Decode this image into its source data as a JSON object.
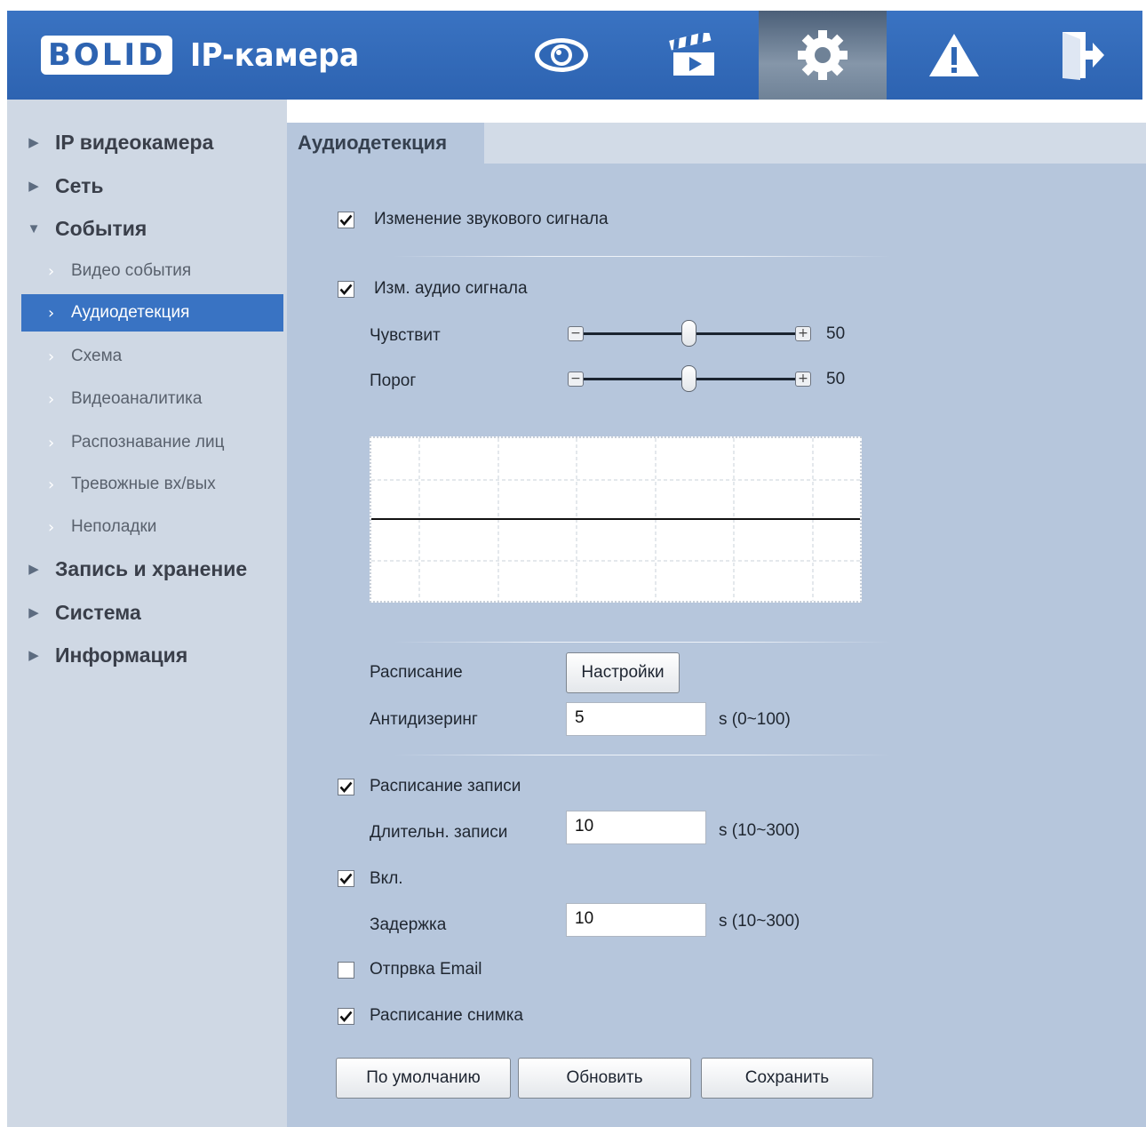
{
  "header": {
    "logo_text": "BOLID",
    "app_title": "IP-камера",
    "nav": [
      "eye-icon",
      "clapperboard-icon",
      "gear-icon",
      "warning-icon",
      "logout-icon"
    ],
    "active_nav": "gear-icon"
  },
  "sidebar": {
    "sections": [
      {
        "label": "IP видеокамера",
        "expanded": false
      },
      {
        "label": "Сеть",
        "expanded": false
      },
      {
        "label": "События",
        "expanded": true
      },
      {
        "label": "Запись и хранение",
        "expanded": false
      },
      {
        "label": "Система",
        "expanded": false
      },
      {
        "label": "Информация",
        "expanded": false
      }
    ],
    "event_items": [
      "Видео события",
      "Аудиодетекция",
      "Схема",
      "Видеоаналитика",
      "Распознавание лиц",
      "Тревожные вх/вых",
      "Неполадки"
    ],
    "active_item": "Аудиодетекция"
  },
  "main": {
    "tab": "Аудиодетекция",
    "sound_change": {
      "label": "Изменение звукового сигнала",
      "checked": true
    },
    "audio_change": {
      "label": "Изм. аудио сигнала",
      "checked": true
    },
    "sensitivity": {
      "label": "Чувствит",
      "value": "50",
      "level": 0.5
    },
    "threshold": {
      "label": "Порог",
      "value": "50",
      "level": 0.5
    },
    "schedule": {
      "label": "Расписание",
      "button": "Настройки"
    },
    "antidither": {
      "label": "Антидизеринг",
      "value": "5",
      "range": "s (0~100)"
    },
    "record_schedule": {
      "label": "Расписание записи",
      "checked": true
    },
    "record_duration": {
      "label": "Длительн. записи",
      "value": "10",
      "range": "s (10~300)"
    },
    "enable": {
      "label": "Вкл.",
      "checked": true
    },
    "delay": {
      "label": "Задержка",
      "value": "10",
      "range": "s (10~300)"
    },
    "send_email": {
      "label": "Отпрвка Email",
      "checked": false
    },
    "snapshot_schedule": {
      "label": "Расписание снимка",
      "checked": true
    },
    "buttons": {
      "default": "По умолчанию",
      "refresh": "Обновить",
      "save": "Сохранить"
    }
  },
  "colors": {
    "header": "#2d63b1",
    "sidebar": "#cfd8e4",
    "active_item": "#3973c3",
    "panel": "#b6c6dc"
  }
}
